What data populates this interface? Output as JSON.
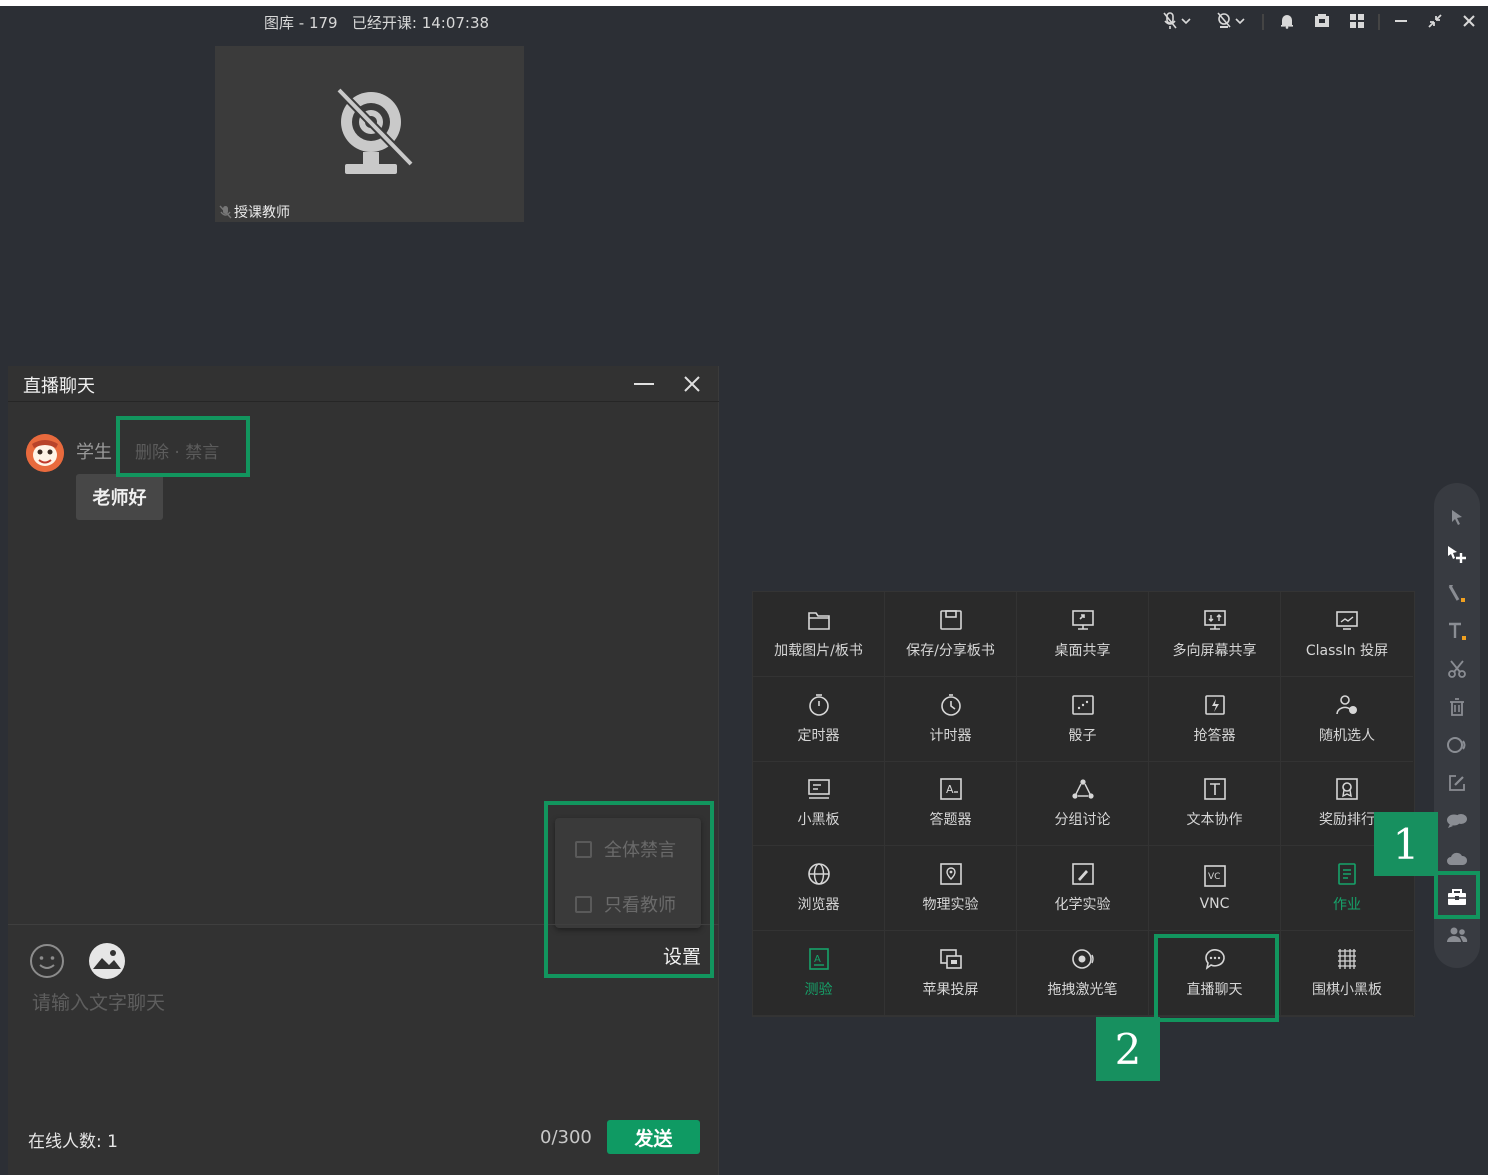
{
  "titlebar": {
    "info": "图库 - 179   已经开课: 14:07:38",
    "controls": [
      "mic-icon",
      "camera-icon",
      "bell-icon",
      "screen-icon",
      "grid-icon",
      "minimize-icon",
      "restore-icon",
      "close-icon"
    ]
  },
  "video": {
    "label": "授课教师"
  },
  "chat": {
    "title": "直播聊天",
    "messages": [
      {
        "sender": "学生",
        "actions": "删除 · 禁言",
        "text": "老师好"
      }
    ],
    "input_placeholder": "请输入文字聊天",
    "settings": {
      "label": "设置",
      "options": [
        {
          "label": "全体禁言",
          "checked": false
        },
        {
          "label": "只看教师",
          "checked": false
        }
      ]
    },
    "online": "在线人数: 1",
    "counter": "0/300",
    "send_label": "发送"
  },
  "annotations": {
    "step1": "1",
    "step2": "2",
    "highlight_color": "#12955e"
  },
  "toolbox": {
    "items": [
      {
        "label": "加载图片/板书",
        "icon": "folder-icon"
      },
      {
        "label": "保存/分享板书",
        "icon": "save-icon"
      },
      {
        "label": "桌面共享",
        "icon": "desktop-share-icon"
      },
      {
        "label": "多向屏幕共享",
        "icon": "multi-screen-icon"
      },
      {
        "label": "ClassIn 投屏",
        "icon": "cast-icon"
      },
      {
        "label": "定时器",
        "icon": "timer-icon"
      },
      {
        "label": "计时器",
        "icon": "stopwatch-icon"
      },
      {
        "label": "骰子",
        "icon": "dice-icon"
      },
      {
        "label": "抢答器",
        "icon": "buzzer-icon"
      },
      {
        "label": "随机选人",
        "icon": "random-user-icon"
      },
      {
        "label": "小黑板",
        "icon": "blackboard-icon"
      },
      {
        "label": "答题器",
        "icon": "answer-icon"
      },
      {
        "label": "分组讨论",
        "icon": "group-icon"
      },
      {
        "label": "文本协作",
        "icon": "text-collab-icon"
      },
      {
        "label": "奖励排行",
        "icon": "award-icon"
      },
      {
        "label": "浏览器",
        "icon": "globe-icon"
      },
      {
        "label": "物理实验",
        "icon": "physics-icon"
      },
      {
        "label": "化学实验",
        "icon": "chemistry-icon"
      },
      {
        "label": "VNC",
        "icon": "vnc-icon"
      },
      {
        "label": "作业",
        "icon": "homework-icon",
        "color": "#16a36a"
      },
      {
        "label": "测验",
        "icon": "quiz-icon",
        "color": "#16a36a"
      },
      {
        "label": "苹果投屏",
        "icon": "airplay-icon"
      },
      {
        "label": "拖拽激光笔",
        "icon": "laser-icon"
      },
      {
        "label": "直播聊天",
        "icon": "chat-icon"
      },
      {
        "label": "围棋小黑板",
        "icon": "go-board-icon"
      }
    ]
  },
  "rail": {
    "tools": [
      "select-icon",
      "add-select-icon",
      "pen-icon",
      "text-icon",
      "scissors-icon",
      "trash-icon",
      "shape-icon",
      "edit-icon",
      "comment-icon",
      "cloud-icon",
      "toolbox-icon",
      "users-icon"
    ]
  }
}
